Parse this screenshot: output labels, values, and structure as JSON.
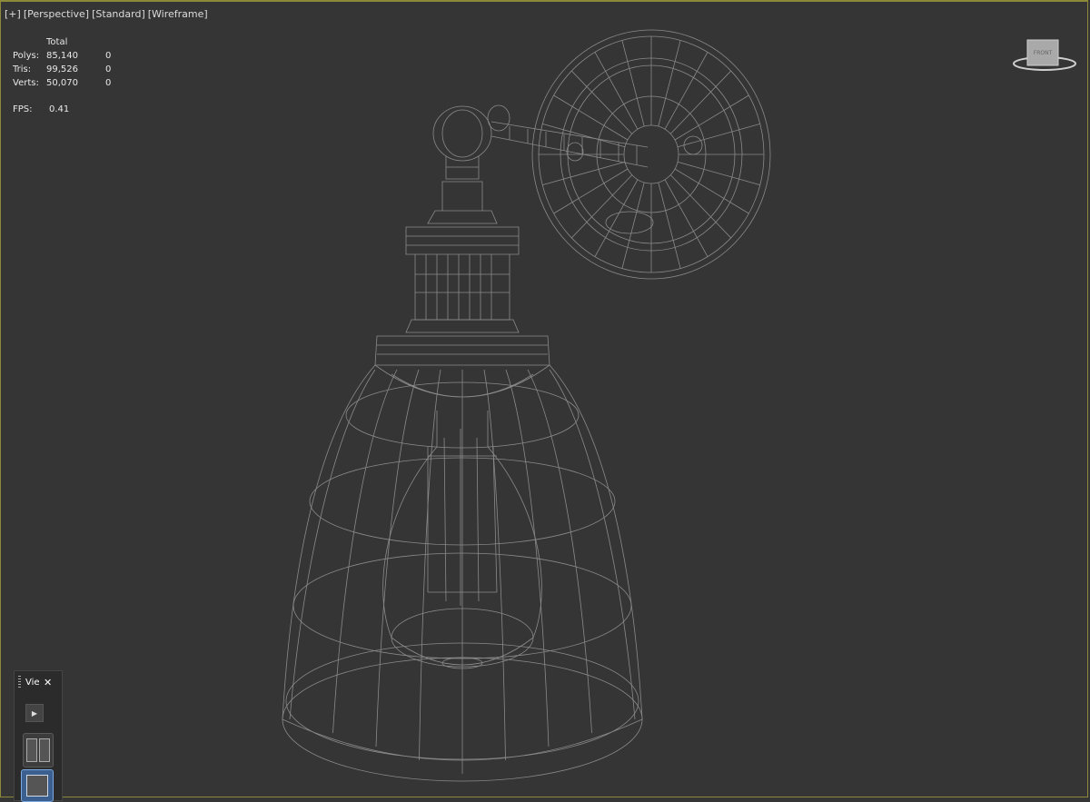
{
  "viewport": {
    "menu": [
      "[+]",
      "[Perspective]",
      "[Standard]",
      "[Wireframe]"
    ]
  },
  "stats": {
    "header": "Total",
    "rows": [
      {
        "label": "Polys:",
        "total": "85,140",
        "selected": "0"
      },
      {
        "label": "Tris:",
        "total": "99,526",
        "selected": "0"
      },
      {
        "label": "Verts:",
        "total": "50,070",
        "selected": "0"
      }
    ],
    "fps_label": "FPS:",
    "fps_value": "0.41"
  },
  "viewcube": {
    "face_label": "FRONT"
  },
  "mini_panel": {
    "title": "View",
    "close": "✕",
    "play": "▶"
  },
  "colors": {
    "viewport_bg": "#353535",
    "wire": "#8a8a8a",
    "active_border": "#8c8a3a"
  }
}
